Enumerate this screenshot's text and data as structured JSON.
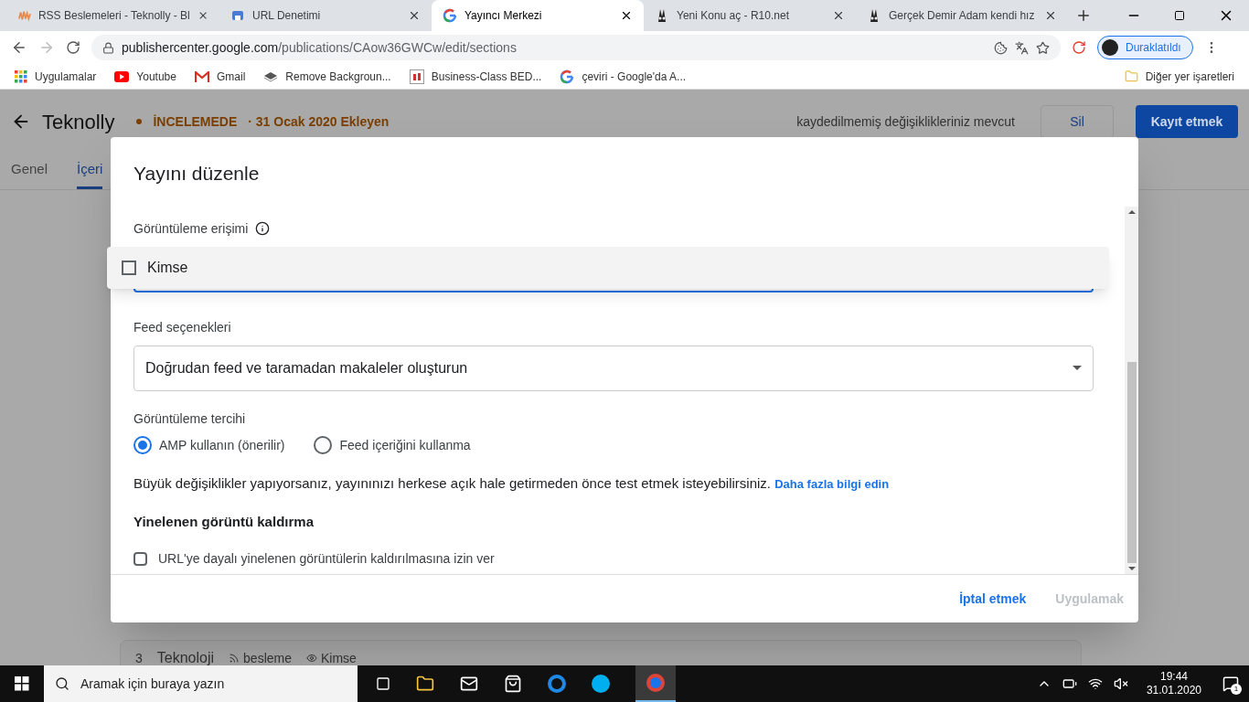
{
  "browser": {
    "tabs": [
      {
        "title": "RSS Beslemeleri - Teknolly - Bl",
        "selected": false,
        "kind": "rss"
      },
      {
        "title": "URL Denetimi",
        "selected": false,
        "kind": "url"
      },
      {
        "title": "Yayıncı Merkezi",
        "selected": true,
        "kind": "google"
      },
      {
        "title": "Yeni Konu aç - R10.net",
        "selected": false,
        "kind": "r10"
      },
      {
        "title": "Gerçek Demir Adam kendi hız",
        "selected": false,
        "kind": "r10"
      }
    ],
    "url_host": "publishercenter.google.com",
    "url_path": "/publications/CAow36GWCw/edit/sections",
    "profile_label": "Duraklatıldı",
    "bookmarks": [
      {
        "label": "Uygulamalar",
        "kind": "apps"
      },
      {
        "label": "Youtube",
        "kind": "youtube"
      },
      {
        "label": "Gmail",
        "kind": "gmail"
      },
      {
        "label": "Remove Backgroun...",
        "kind": "layers"
      },
      {
        "label": "Business-Class BED...",
        "kind": "nf"
      },
      {
        "label": "çeviri - Google'da A...",
        "kind": "google"
      }
    ],
    "other_bookmarks": "Diğer yer işaretleri"
  },
  "page": {
    "title": "Teknolly",
    "status": "İNCELEMEDE",
    "added": "· 31 Ocak 2020 Ekleyen",
    "unsaved": "kaydedilmemiş değişiklikleriniz mevcut",
    "delete_button": "Sil",
    "save_button": "Kayıt etmek",
    "tabs": [
      {
        "label": "Genel",
        "selected": false
      },
      {
        "label": "İçeri",
        "selected": true
      }
    ],
    "section_card": {
      "number": "3",
      "name": "Teknoloji",
      "source": "besleme",
      "visibility": "Kimse"
    }
  },
  "dialog": {
    "title": "Yayını düzenle",
    "access_label": "Görüntüleme erişimi",
    "access_menu": [
      {
        "label": "Kimse",
        "checked": false
      }
    ],
    "feed_label": "Feed seçenekleri",
    "feed_value": "Doğrudan feed ve taramadan makaleler oluşturun",
    "display_label": "Görüntüleme tercihi",
    "display_options": [
      {
        "label": "AMP kullanın (önerilir)",
        "selected": true
      },
      {
        "label": "Feed içeriğini kullanma",
        "selected": false
      }
    ],
    "note": "Büyük değişiklikler yapıyorsanız, yayınınızı herkese açık hale getirmeden önce test etmek isteyebilirsiniz.",
    "note_link": "Daha fazla bilgi edin",
    "dedupe_heading": "Yinelenen görüntü kaldırma",
    "dedupe_options": [
      {
        "label": "URL'ye dayalı yinelenen görüntülerin kaldırılmasına izin ver",
        "checked": false
      }
    ],
    "cancel_button": "İptal etmek",
    "apply_button": {
      "label": "Uygulamak",
      "disabled": true
    }
  },
  "taskbar": {
    "search_placeholder": "Aramak için buraya yazın",
    "time": "19:44",
    "date": "31.01.2020",
    "notifications": "1"
  }
}
